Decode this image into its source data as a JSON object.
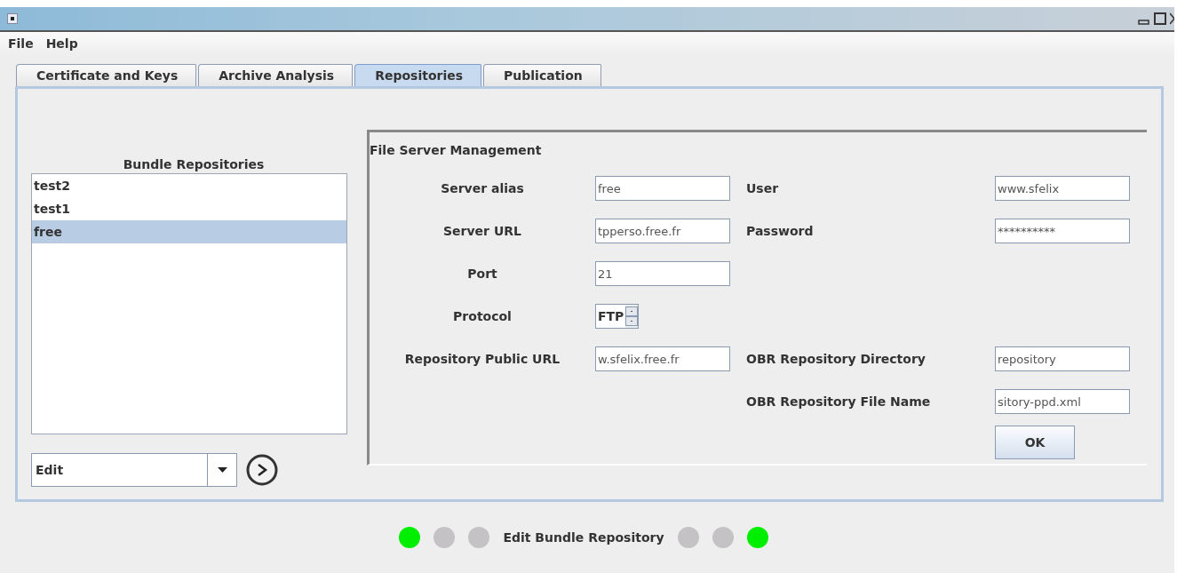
{
  "menu": [
    {
      "label": "File"
    },
    {
      "label": "Help"
    }
  ],
  "tabs": [
    {
      "label": "Certificate and Keys",
      "selected": false
    },
    {
      "label": "Archive Analysis",
      "selected": false
    },
    {
      "label": "Repositories",
      "selected": true
    },
    {
      "label": "Publication",
      "selected": false
    }
  ],
  "repositories": {
    "title": "Bundle Repositories",
    "items": [
      {
        "label": "test2",
        "selected": false
      },
      {
        "label": "test1",
        "selected": false
      },
      {
        "label": "free",
        "selected": true
      }
    ],
    "action": {
      "value": "Edit"
    }
  },
  "server_form": {
    "title": "File Server Management",
    "rows": [
      {
        "left": {
          "label": "Server alias",
          "value": "free",
          "kind": "text"
        },
        "right": {
          "label": "User",
          "value": "www.sfelix",
          "kind": "text"
        }
      },
      {
        "left": {
          "label": "Server URL",
          "value": "tpperso.free.fr",
          "kind": "text"
        },
        "right": {
          "label": "Password",
          "value": "**********",
          "kind": "text"
        }
      },
      {
        "left": {
          "label": "Port",
          "value": "21",
          "kind": "text"
        }
      },
      {
        "left": {
          "label": "Protocol",
          "value": "FTP",
          "kind": "spinner"
        }
      },
      {
        "left": {
          "label": "Repository Public URL",
          "value": "w.sfelix.free.fr",
          "kind": "text"
        },
        "right": {
          "label": "OBR Repository Directory",
          "value": "repository",
          "kind": "text"
        }
      },
      {
        "right": {
          "label": "OBR Repository File Name",
          "value": "sitory-ppd.xml",
          "kind": "text"
        }
      }
    ],
    "ok_button": "OK"
  },
  "status": {
    "lights_left": [
      {
        "color": "#00ee00"
      },
      {
        "color": "#c4c2c4"
      },
      {
        "color": "#c4c2c4"
      }
    ],
    "label": "Edit Bundle Repository",
    "lights_right": [
      {
        "color": "#c4c2c4"
      },
      {
        "color": "#c4c2c4"
      },
      {
        "color": "#00ee00"
      }
    ]
  }
}
